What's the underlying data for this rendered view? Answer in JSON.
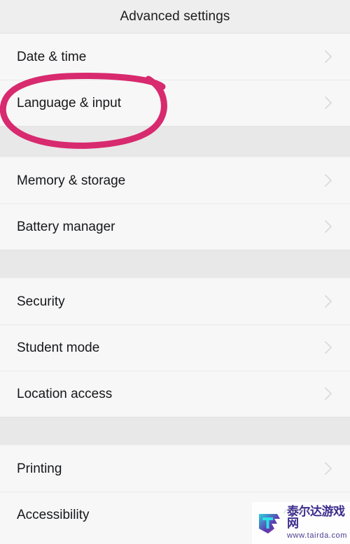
{
  "header": {
    "title": "Advanced settings"
  },
  "colors": {
    "page_background": "#f7f7f7",
    "header_background": "#eeeeee",
    "band_background": "#e8e8e8",
    "separator": "#e9e9e9",
    "text_primary": "#16171a",
    "chevron": "#c4c4c4",
    "annotation_pink": "#d82a6e",
    "watermark_purple": "#3b2c8c"
  },
  "list": {
    "groups": [
      {
        "name": "group-1",
        "rows": [
          {
            "label": "Date & time",
            "chevron": "chevron-right-icon"
          },
          {
            "label": "Language & input",
            "chevron": "chevron-right-icon"
          }
        ]
      },
      {
        "name": "group-2",
        "rows": [
          {
            "label": "Memory & storage",
            "chevron": "chevron-right-icon"
          },
          {
            "label": "Battery manager",
            "chevron": "chevron-right-icon"
          }
        ]
      },
      {
        "name": "group-3",
        "rows": [
          {
            "label": "Security",
            "chevron": "chevron-right-icon"
          },
          {
            "label": "Student mode",
            "chevron": "chevron-right-icon"
          },
          {
            "label": "Location access",
            "chevron": "chevron-right-icon"
          }
        ]
      },
      {
        "name": "group-4",
        "rows": [
          {
            "label": "Printing",
            "chevron": "chevron-right-icon"
          },
          {
            "label": "Accessibility",
            "chevron": "chevron-right-icon"
          }
        ]
      }
    ]
  },
  "annotation": {
    "type": "hand-drawn-ellipse",
    "targets": "Language & input",
    "color": "#d82a6e"
  },
  "watermark": {
    "site_name": "泰尔达游戏网",
    "url": "www.tairda.com"
  }
}
